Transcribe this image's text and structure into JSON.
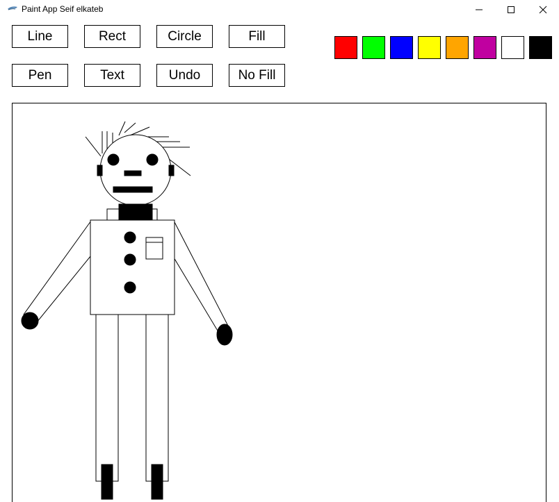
{
  "window": {
    "title": "Paint App Seif elkateb",
    "controls": {
      "minimize_icon": "minimize-icon",
      "maximize_icon": "maximize-icon",
      "close_icon": "close-icon"
    }
  },
  "toolbar": {
    "row1": [
      "Line",
      "Rect",
      "Circle",
      "Fill"
    ],
    "row2": [
      "Pen",
      "Text",
      "Undo",
      "No Fill"
    ]
  },
  "palette": {
    "colors": [
      "#ff0000",
      "#00ff00",
      "#0000ff",
      "#ffff00",
      "#ffa500",
      "#c000a0",
      "#ffffff",
      "#000000"
    ]
  },
  "canvas": {
    "background": "#ffffff",
    "stroke_color": "#000000",
    "fill_color": "#000000"
  }
}
